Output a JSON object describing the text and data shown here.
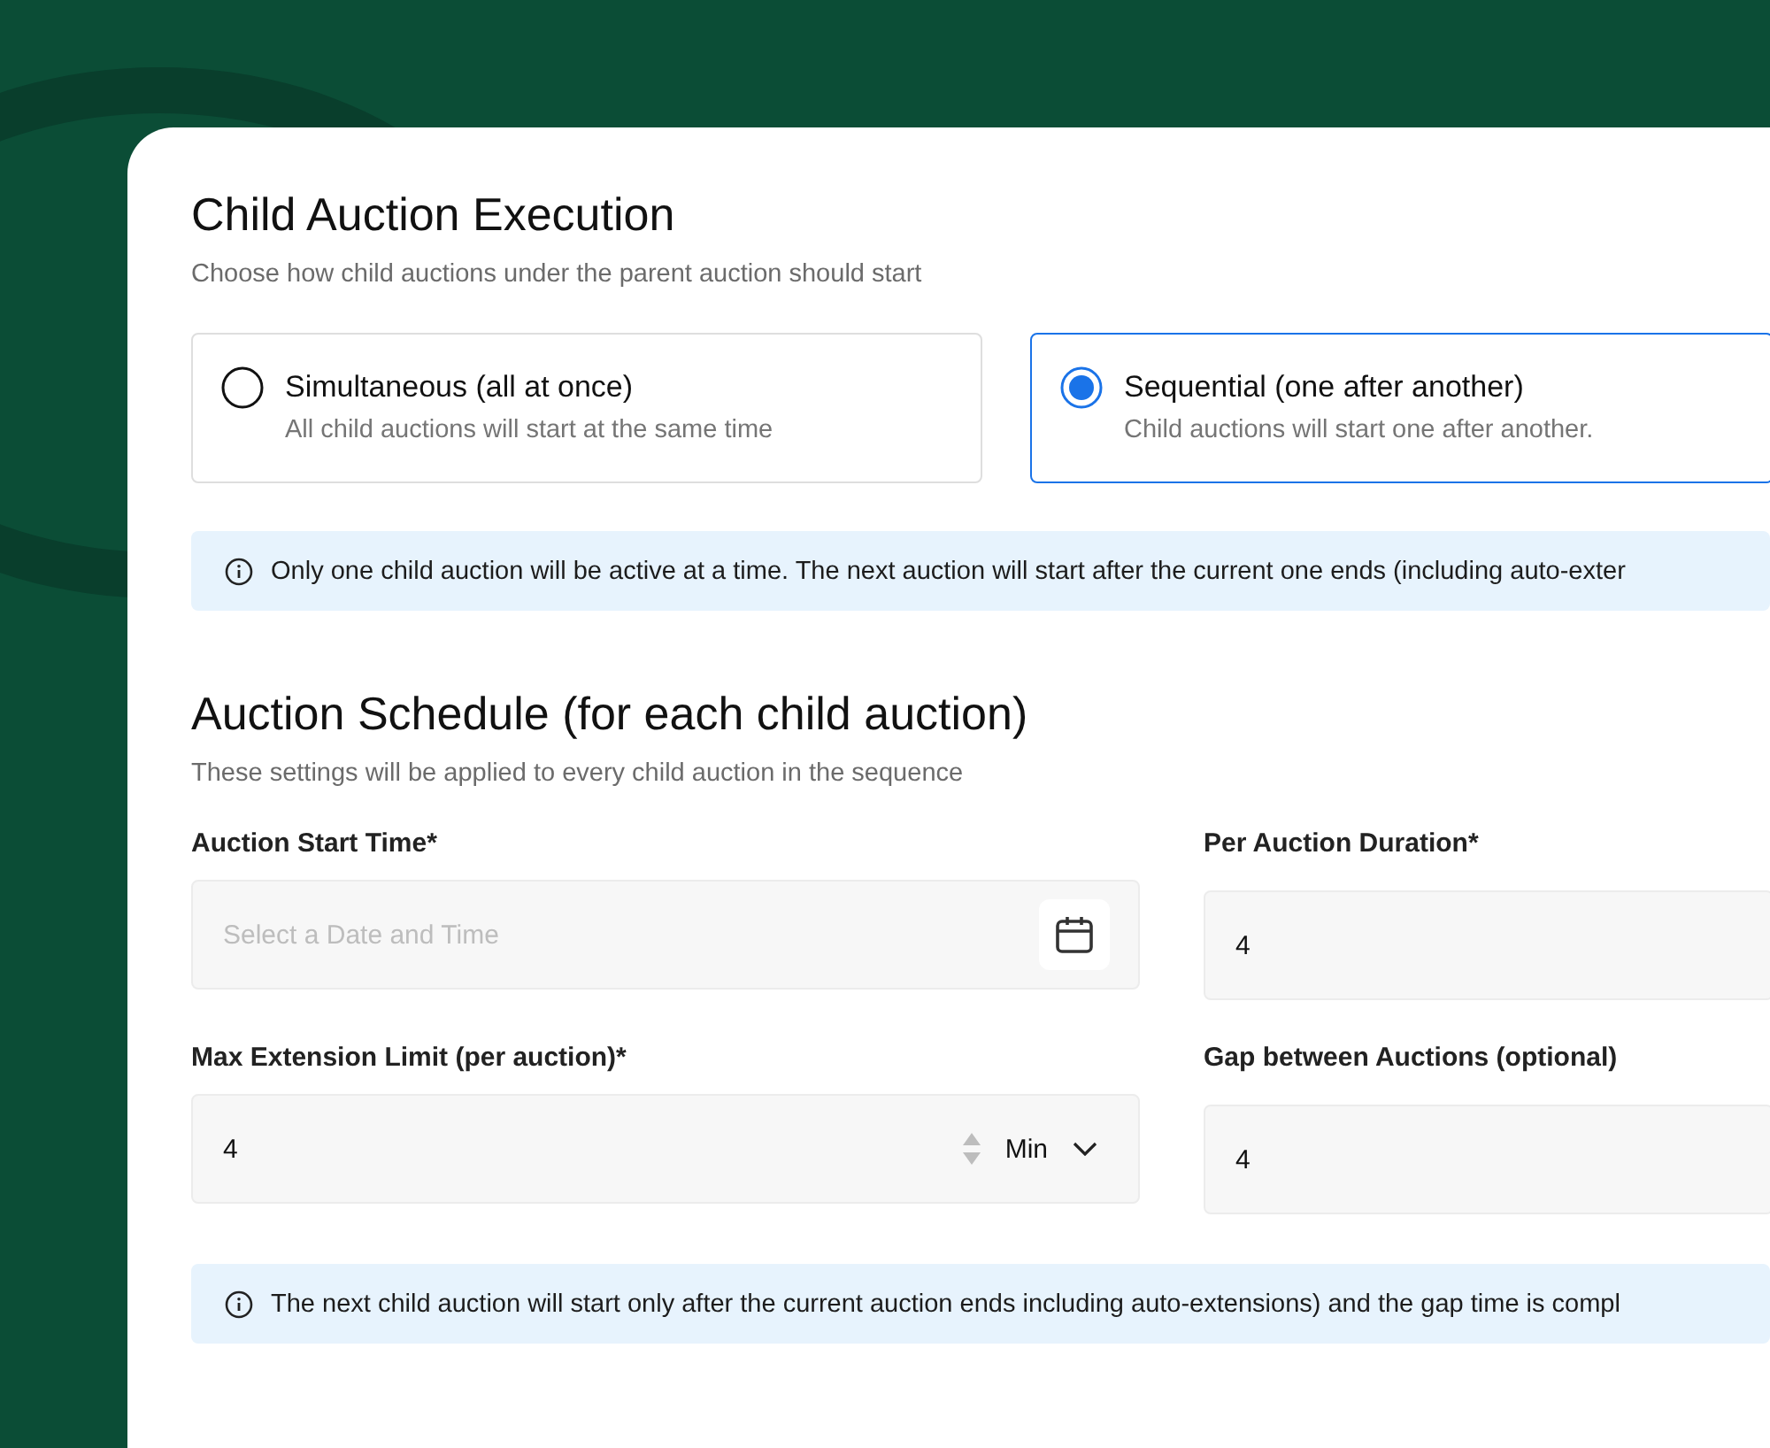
{
  "execution": {
    "title": "Child Auction Execution",
    "subtitle": "Choose how child auctions under the parent auction should start"
  },
  "options": [
    {
      "label": "Simultaneous (all at once)",
      "description": "All child auctions will start at the same time",
      "selected": false
    },
    {
      "label": "Sequential (one after another)",
      "description": "Child auctions will start one after another.",
      "selected": true
    }
  ],
  "execution_note": "Only one child auction will be active at a time. The next auction will start after the current one ends (including auto-exter",
  "schedule": {
    "title": "Auction Schedule (for each child auction)",
    "subtitle": "These settings will be applied to every child auction in the sequence"
  },
  "fields": [
    {
      "kind": "date",
      "label": "Auction Start Time*",
      "placeholder": "Select a Date and Time"
    },
    {
      "kind": "number",
      "label": "Per Auction Duration*",
      "value": "4"
    },
    {
      "kind": "number-unit",
      "label": "Max Extension Limit (per auction)*",
      "value": "4",
      "unit": "Min"
    },
    {
      "kind": "number",
      "label": "Gap between Auctions (optional)",
      "value": "4"
    }
  ],
  "schedule_note": "The next child auction will start only after the current auction ends including auto-extensions) and the gap time is compl"
}
